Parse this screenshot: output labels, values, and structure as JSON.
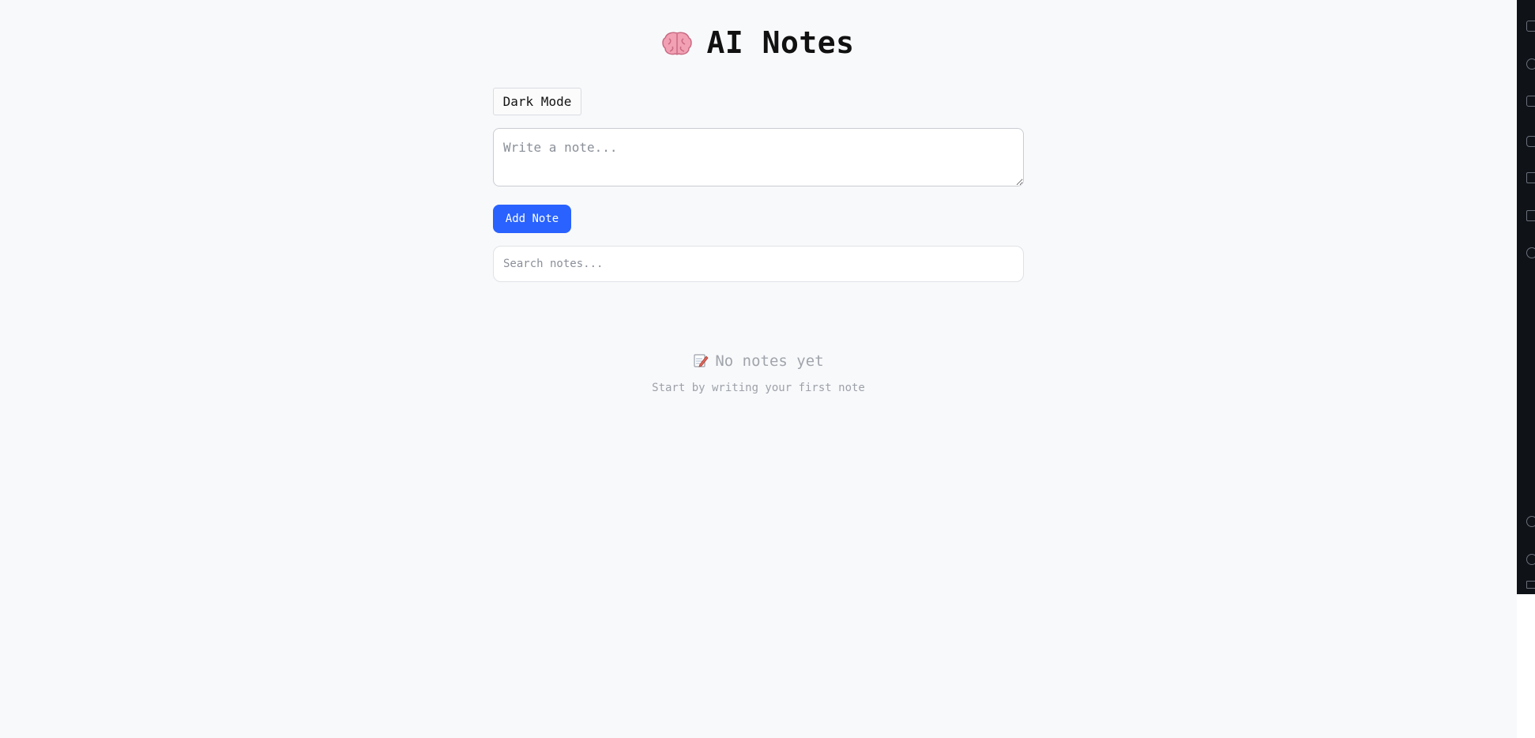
{
  "app": {
    "title": "AI Notes",
    "title_icon": "brain-icon"
  },
  "controls": {
    "dark_mode_label": "Dark Mode",
    "note_placeholder": "Write a note...",
    "add_note_label": "Add Note",
    "search_placeholder": "Search notes..."
  },
  "empty_state": {
    "icon": "memo-icon",
    "title": "No notes yet",
    "subtitle": "Start by writing your first note"
  },
  "colors": {
    "background": "#f8f9fb",
    "accent": "#2962ff",
    "sidebar": "#0f1217"
  },
  "sidebar_icons": [
    "branch-icon",
    "info-icon",
    "stack-icon",
    "bug-icon",
    "monitor-icon",
    "layout-icon",
    "info-icon",
    "account-icon",
    "gear-icon",
    "remote-icon"
  ]
}
